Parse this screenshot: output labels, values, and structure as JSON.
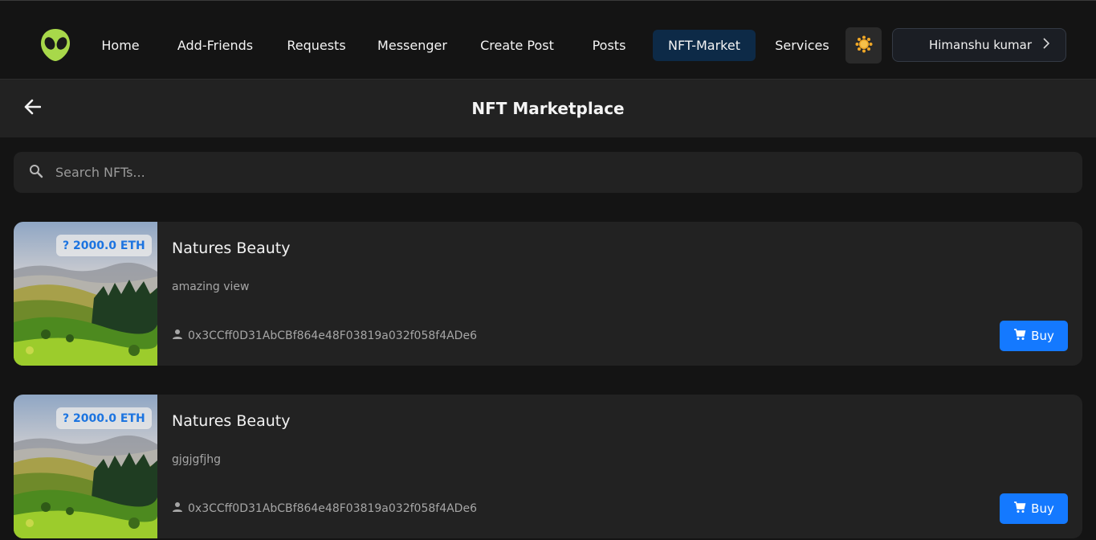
{
  "nav": {
    "items": [
      {
        "label": "Home"
      },
      {
        "label": "Add-Friends"
      },
      {
        "label": "Requests"
      },
      {
        "label": "Messenger"
      },
      {
        "label": "Create Post"
      },
      {
        "label": "Posts"
      },
      {
        "label": "NFT-Market"
      },
      {
        "label": "Services"
      }
    ],
    "active": "NFT-Market",
    "theme_icon": "sun-icon",
    "user": {
      "name": "Himanshu kumar",
      "icon": "chevron-right-icon"
    }
  },
  "header": {
    "title": "NFT Marketplace",
    "back_icon": "arrow-left-icon"
  },
  "search": {
    "placeholder": "Search NFTs...",
    "value": "",
    "icon": "search-icon"
  },
  "listings": [
    {
      "price": "? 2000.0 ETH",
      "title": "Natures Beauty",
      "description": "amazing view",
      "owner": "0x3CCff0D31AbCBf864e48F03819a032f058f4ADe6",
      "buy_label": "Buy"
    },
    {
      "price": "? 2000.0 ETH",
      "title": "Natures Beauty",
      "description": "gjgjgfjhg",
      "owner": "0x3CCff0D31AbCBf864e48F03819a032f058f4ADe6",
      "buy_label": "Buy"
    }
  ],
  "colors": {
    "background": "#141414",
    "surface": "#222222",
    "accent": "#1479ff",
    "active_nav": "#0d2a47",
    "price_text": "#1c74e0"
  }
}
